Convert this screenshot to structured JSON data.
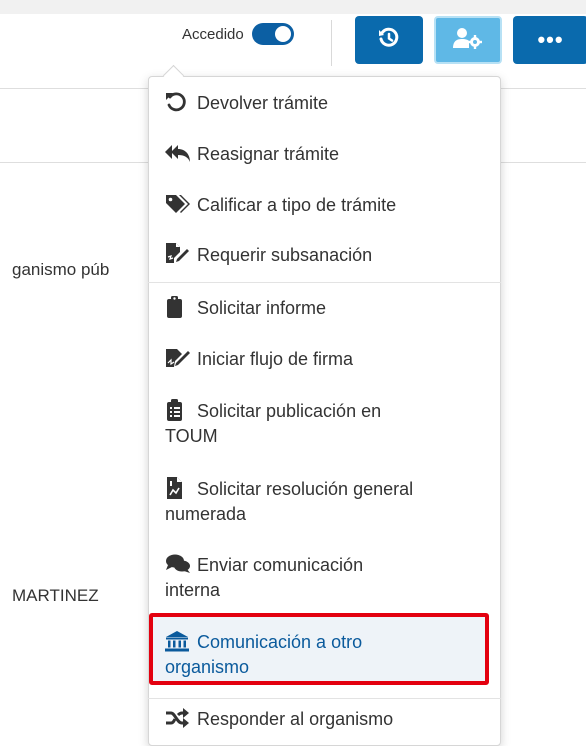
{
  "toolbar": {
    "accedido_label": "Accedido",
    "accedido_on": true,
    "buttons": [
      {
        "name": "history",
        "icon": "history-icon",
        "color": "#0a6aad"
      },
      {
        "name": "user-settings",
        "icon": "user-cog-icon",
        "color": "#5fb8e6"
      },
      {
        "name": "more",
        "icon": "ellipsis-icon",
        "label": "•••",
        "color": "#0a6aad"
      }
    ]
  },
  "background_rows": {
    "organismo_text": "ganismo púb",
    "name_text": "MARTINEZ"
  },
  "menu": {
    "items": [
      {
        "label": "Devolver trámite",
        "icon": "undo-icon"
      },
      {
        "label": "Reasignar trámite",
        "icon": "reply-all-icon"
      },
      {
        "label": "Calificar a tipo de trámite",
        "icon": "tags-icon"
      },
      {
        "label": "Requerir subsanación",
        "icon": "file-signature-icon"
      },
      {
        "label": "Solicitar informe",
        "icon": "clipboard-icon"
      },
      {
        "label": "Iniciar flujo de firma",
        "icon": "signature-icon"
      },
      {
        "label_line1": "Solicitar publicación en",
        "label_line2": "TOUM",
        "icon": "clipboard-list-icon"
      },
      {
        "label_line1": "Solicitar resolución general",
        "label_line2": "numerada",
        "icon": "file-chart-icon"
      },
      {
        "label_line1": "Enviar comunicación",
        "label_line2": "interna",
        "icon": "comments-icon"
      },
      {
        "label_line1": "Comunicación a otro",
        "label_line2": "organismo",
        "icon": "university-icon",
        "highlighted": true
      },
      {
        "label": "Responder al organismo",
        "icon": "random-icon"
      }
    ]
  },
  "colors": {
    "primary": "#0a6aad",
    "accent_light": "#5fb8e6",
    "highlight_border": "#e3000f"
  }
}
